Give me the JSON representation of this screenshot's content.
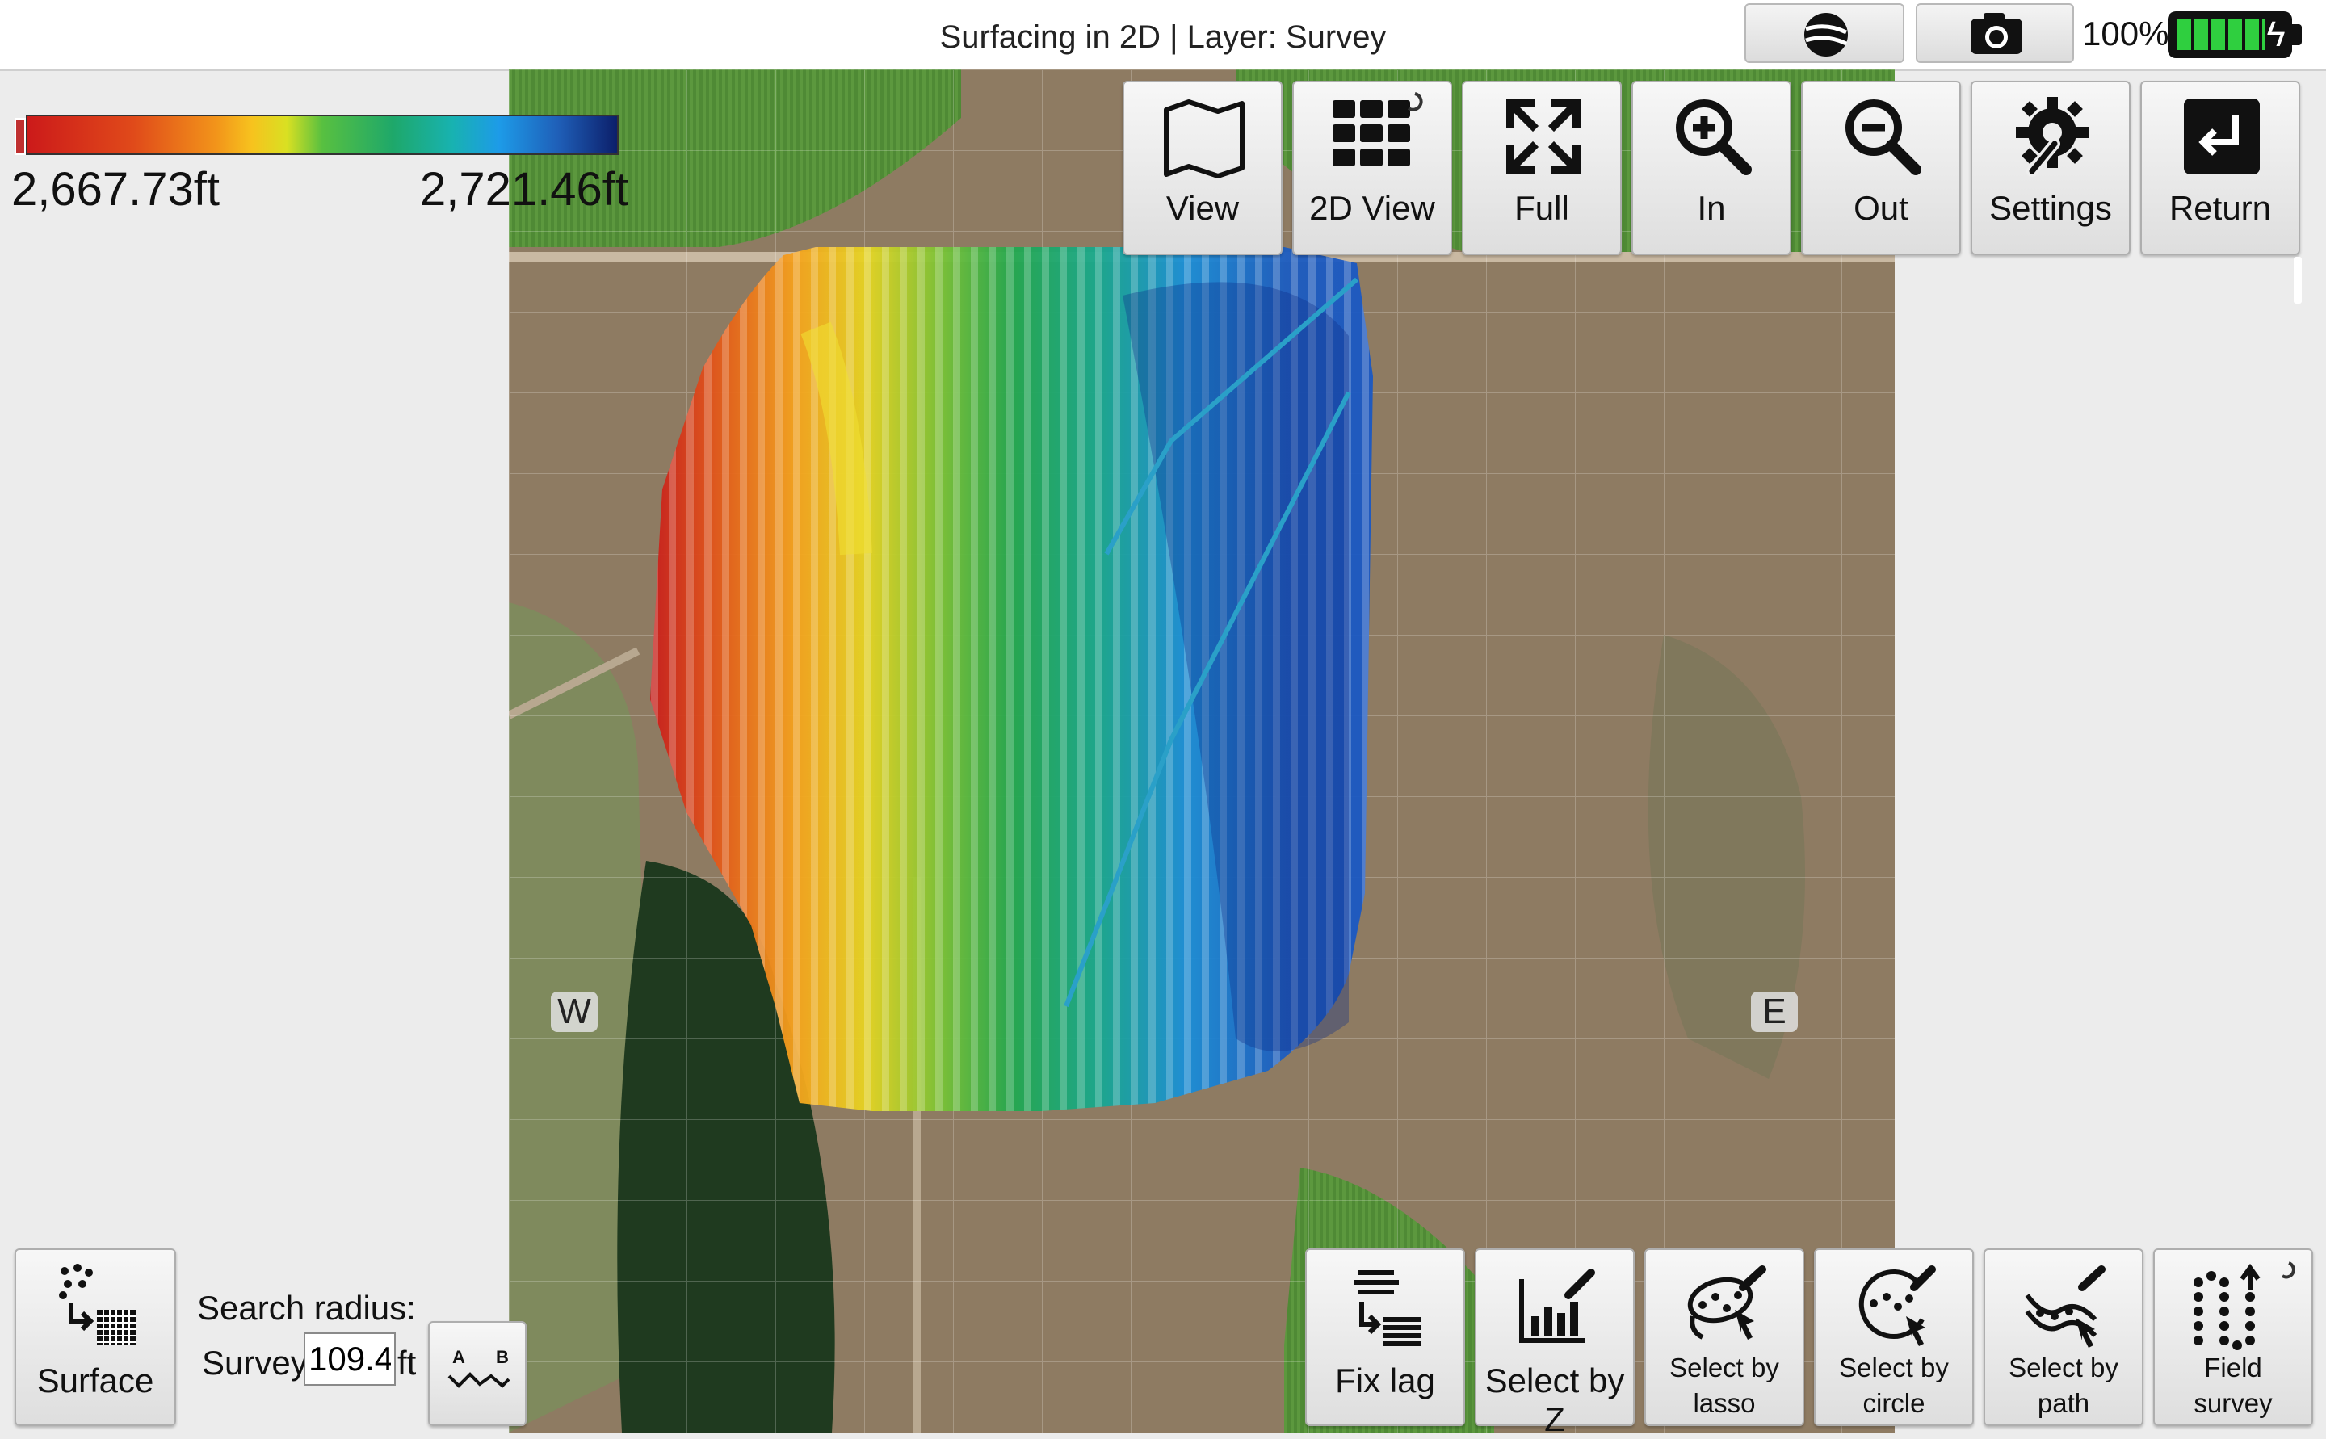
{
  "window": {
    "title": "Surfacing in 2D | Layer: Survey"
  },
  "status": {
    "battery_percent": "100%",
    "battery_icon": "battery-charging-icon",
    "globe_icon": "globe-icon",
    "camera_icon": "camera-icon"
  },
  "legend": {
    "min_label": "2,667.73ft",
    "max_label": "2,721.46ft",
    "colors": [
      "#cc1a1a",
      "#f2941a",
      "#d9e022",
      "#1ea86a",
      "#1d9be8",
      "#0c1f6a"
    ]
  },
  "toolbar": [
    {
      "id": "view",
      "label": "View",
      "icon": "map-icon"
    },
    {
      "id": "2dview",
      "label": "2D View",
      "icon": "grid-icon"
    },
    {
      "id": "full",
      "label": "Full",
      "icon": "fullscreen-icon"
    },
    {
      "id": "in",
      "label": "In",
      "icon": "zoom-in-icon"
    },
    {
      "id": "out",
      "label": "Out",
      "icon": "zoom-out-icon"
    },
    {
      "id": "settings",
      "label": "Settings",
      "icon": "settings-icon"
    },
    {
      "id": "return",
      "label": "Return",
      "icon": "return-icon"
    }
  ],
  "compass": {
    "west": "W",
    "east": "E"
  },
  "surface_button": {
    "label": "Surface",
    "icon": "surface-icon"
  },
  "search": {
    "label": "Search radius:",
    "layer": "Survey",
    "value": "109.4",
    "unit": "ft"
  },
  "ab_button": {
    "icon": "ab-line-icon",
    "a": "A",
    "b": "B"
  },
  "bottom_tools": [
    {
      "id": "fixlag",
      "label": "Fix lag",
      "icon": "fix-lag-icon"
    },
    {
      "id": "selectz",
      "label": "Select by Z",
      "icon": "select-z-icon"
    },
    {
      "id": "lasso",
      "label1": "Select by",
      "label2": "lasso",
      "icon": "lasso-icon"
    },
    {
      "id": "circle",
      "label1": "Select by",
      "label2": "circle",
      "icon": "circle-select-icon"
    },
    {
      "id": "path",
      "label1": "Select by",
      "label2": "path",
      "icon": "path-select-icon"
    },
    {
      "id": "field",
      "label1": "Field",
      "label2": "survey",
      "icon": "field-survey-icon"
    }
  ]
}
